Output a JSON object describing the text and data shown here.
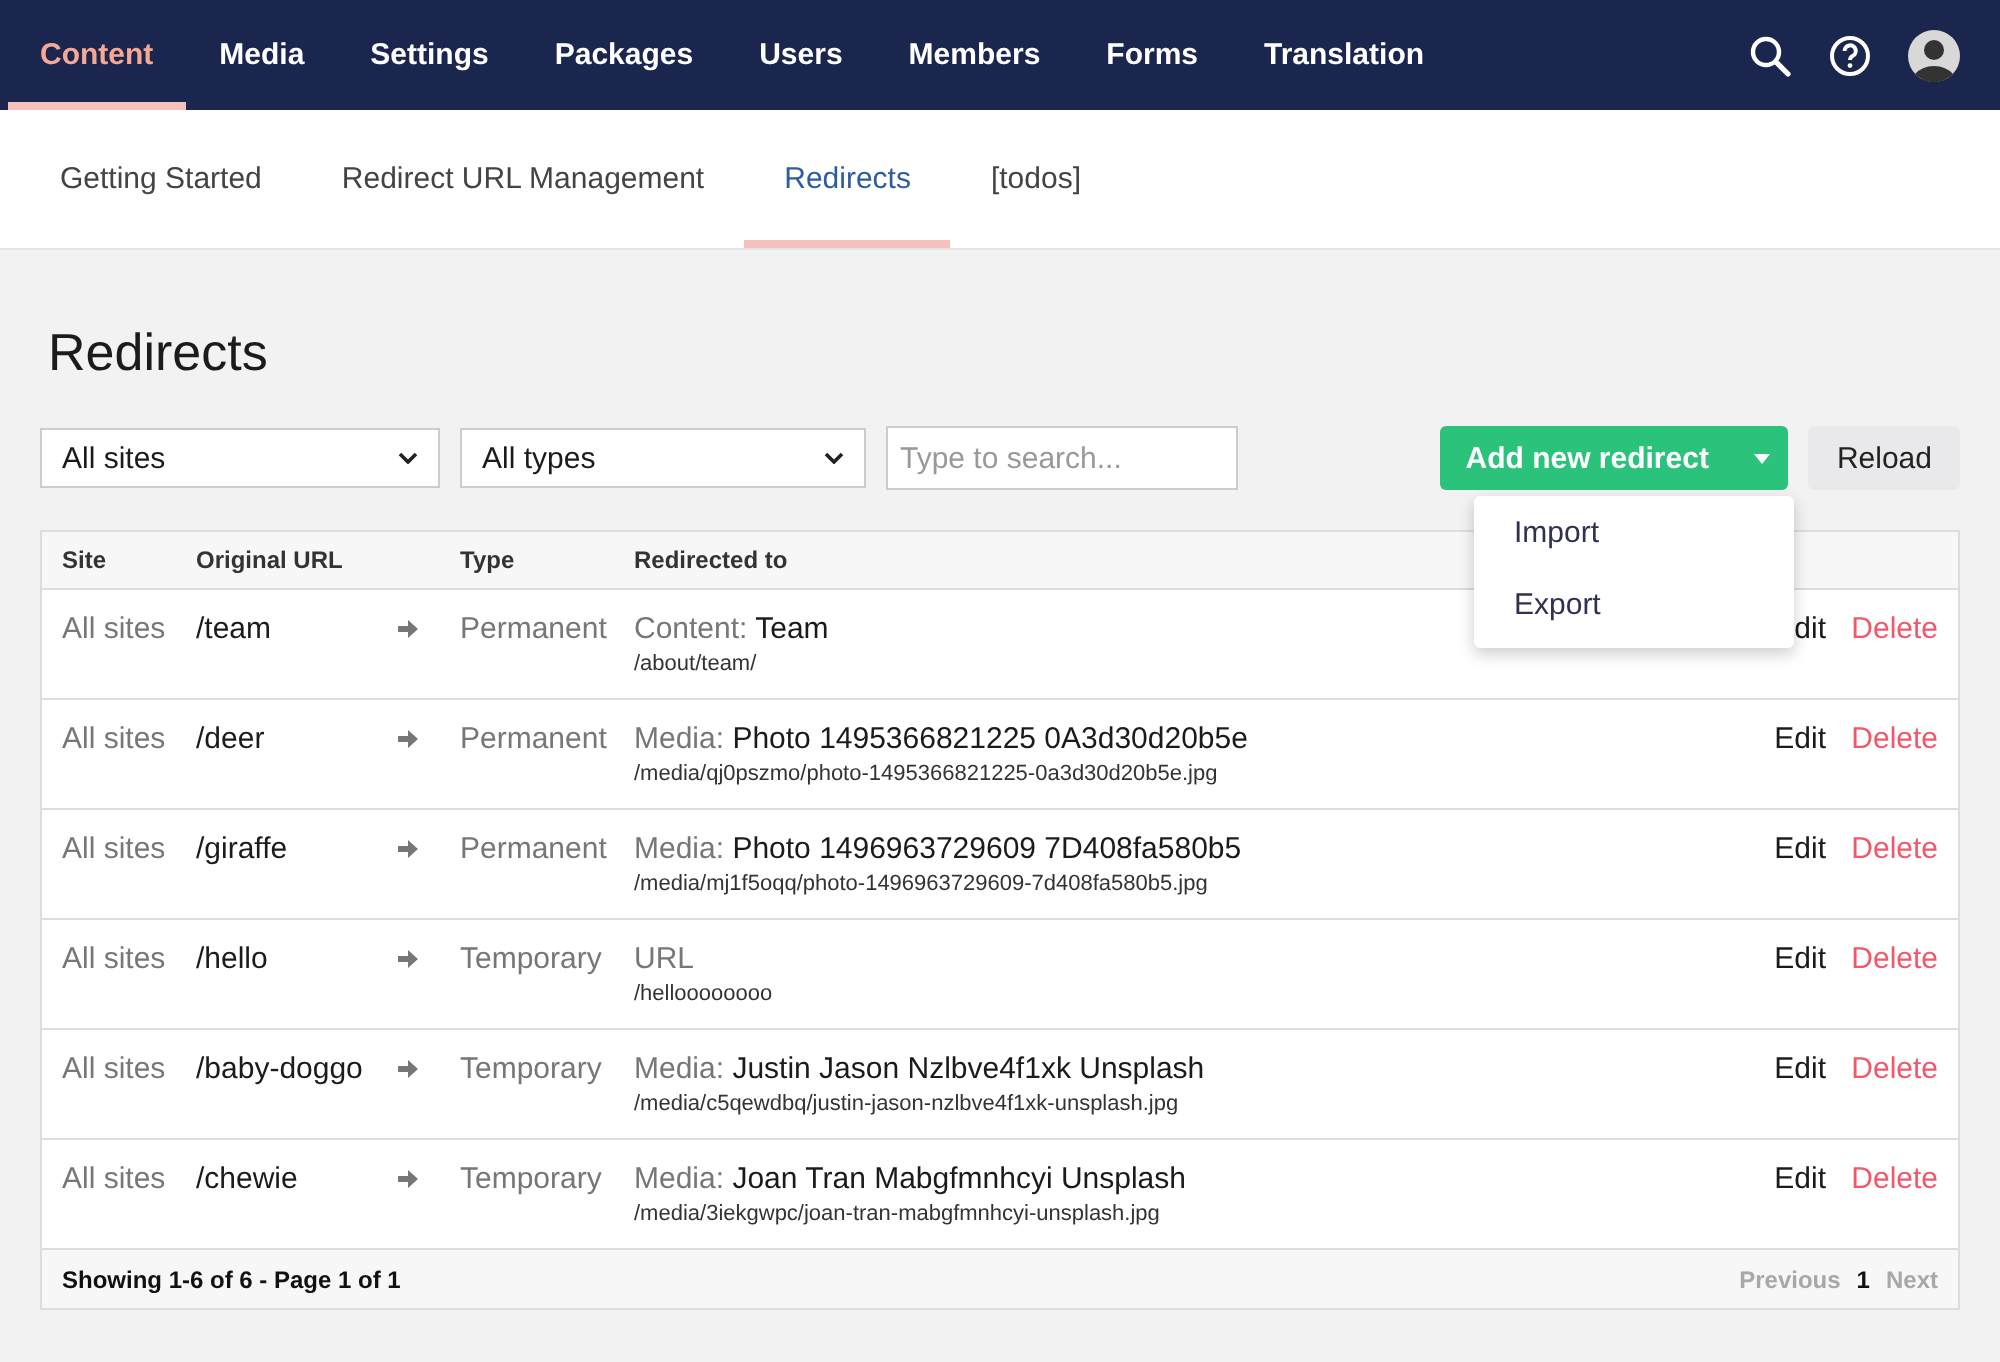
{
  "top_nav": {
    "sections": [
      {
        "label": "Content",
        "selected": true
      },
      {
        "label": "Media",
        "selected": false
      },
      {
        "label": "Settings",
        "selected": false
      },
      {
        "label": "Packages",
        "selected": false
      },
      {
        "label": "Users",
        "selected": false
      },
      {
        "label": "Members",
        "selected": false
      },
      {
        "label": "Forms",
        "selected": false
      },
      {
        "label": "Translation",
        "selected": false
      }
    ]
  },
  "sub_tabs": [
    {
      "label": "Getting Started",
      "selected": false
    },
    {
      "label": "Redirect URL Management",
      "selected": false
    },
    {
      "label": "Redirects",
      "selected": true
    },
    {
      "label": "[todos]",
      "selected": false
    }
  ],
  "page_title": "Redirects",
  "filters": {
    "site": "All sites",
    "type": "All types",
    "search_placeholder": "Type to search..."
  },
  "add_button": {
    "label": "Add new redirect",
    "expanded": true,
    "menu": [
      "Import",
      "Export"
    ]
  },
  "reload_button": "Reload",
  "table": {
    "columns": [
      "Site",
      "Original URL",
      "Type",
      "Redirected to"
    ],
    "rows": [
      {
        "site": "All sites",
        "original_url": "/team",
        "type": "Permanent",
        "target_kind": "Content:",
        "target_name": "Team",
        "target_path": "/about/team/",
        "edit": "dit",
        "delete": "Delete"
      },
      {
        "site": "All sites",
        "original_url": "/deer",
        "type": "Permanent",
        "target_kind": "Media:",
        "target_name": "Photo 1495366821225 0A3d30d20b5e",
        "target_path": "/media/qj0pszmo/photo-1495366821225-0a3d30d20b5e.jpg",
        "edit": "Edit",
        "delete": "Delete"
      },
      {
        "site": "All sites",
        "original_url": "/giraffe",
        "type": "Permanent",
        "target_kind": "Media:",
        "target_name": "Photo 1496963729609 7D408fa580b5",
        "target_path": "/media/mj1f5oqq/photo-1496963729609-7d408fa580b5.jpg",
        "edit": "Edit",
        "delete": "Delete"
      },
      {
        "site": "All sites",
        "original_url": "/hello",
        "type": "Temporary",
        "target_kind": "URL",
        "target_path": "/helloooooooo",
        "edit": "Edit",
        "delete": "Delete"
      },
      {
        "site": "All sites",
        "original_url": "/baby-doggo",
        "type": "Temporary",
        "target_kind": "Media:",
        "target_name": "Justin Jason Nzlbve4f1xk Unsplash",
        "target_path": "/media/c5qewdbq/justin-jason-nzlbve4f1xk-unsplash.jpg",
        "edit": "Edit",
        "delete": "Delete"
      },
      {
        "site": "All sites",
        "original_url": "/chewie",
        "type": "Temporary",
        "target_kind": "Media:",
        "target_name": "Joan Tran Mabgfmnhcyi Unsplash",
        "target_path": "/media/3iekgwpc/joan-tran-mabgfmnhcyi-unsplash.jpg",
        "edit": "Edit",
        "delete": "Delete"
      }
    ]
  },
  "pagination": {
    "summary": "Showing 1-6 of 6 - Page 1 of 1",
    "previous": {
      "label": "Previous",
      "disabled": true
    },
    "pages": [
      {
        "label": "1",
        "selected": true
      }
    ],
    "next": {
      "label": "Next",
      "disabled": true
    }
  }
}
